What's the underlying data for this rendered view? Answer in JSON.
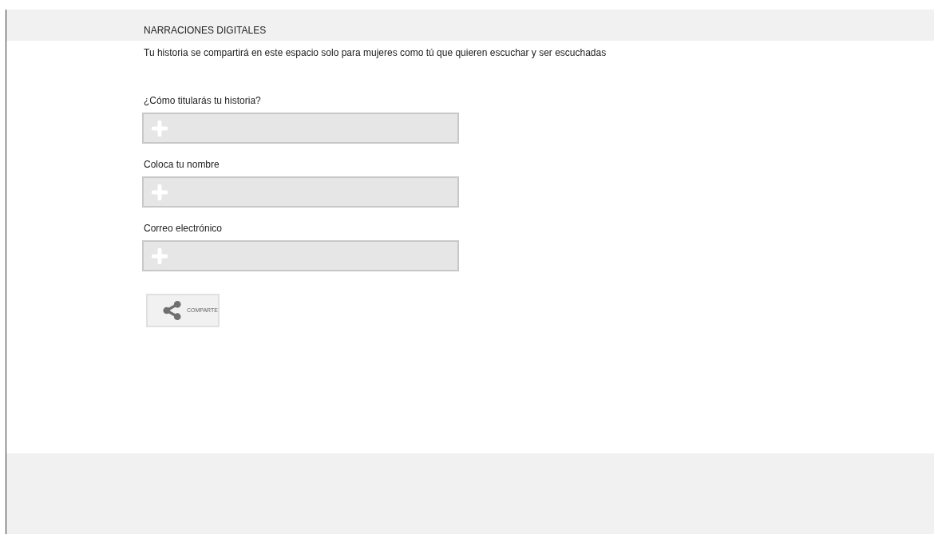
{
  "header": {
    "title": "NARRACIONES DIGITALES"
  },
  "intro": "Tu historia se compartirá en este espacio solo para mujeres como tú que quieren escuchar y ser escuchadas",
  "fields": [
    {
      "label": "¿Cómo titularás tu historia?"
    },
    {
      "label": "Coloca tu nombre"
    },
    {
      "label": "Correo electrónico"
    }
  ],
  "share_button": {
    "label": "COMPARTE"
  }
}
